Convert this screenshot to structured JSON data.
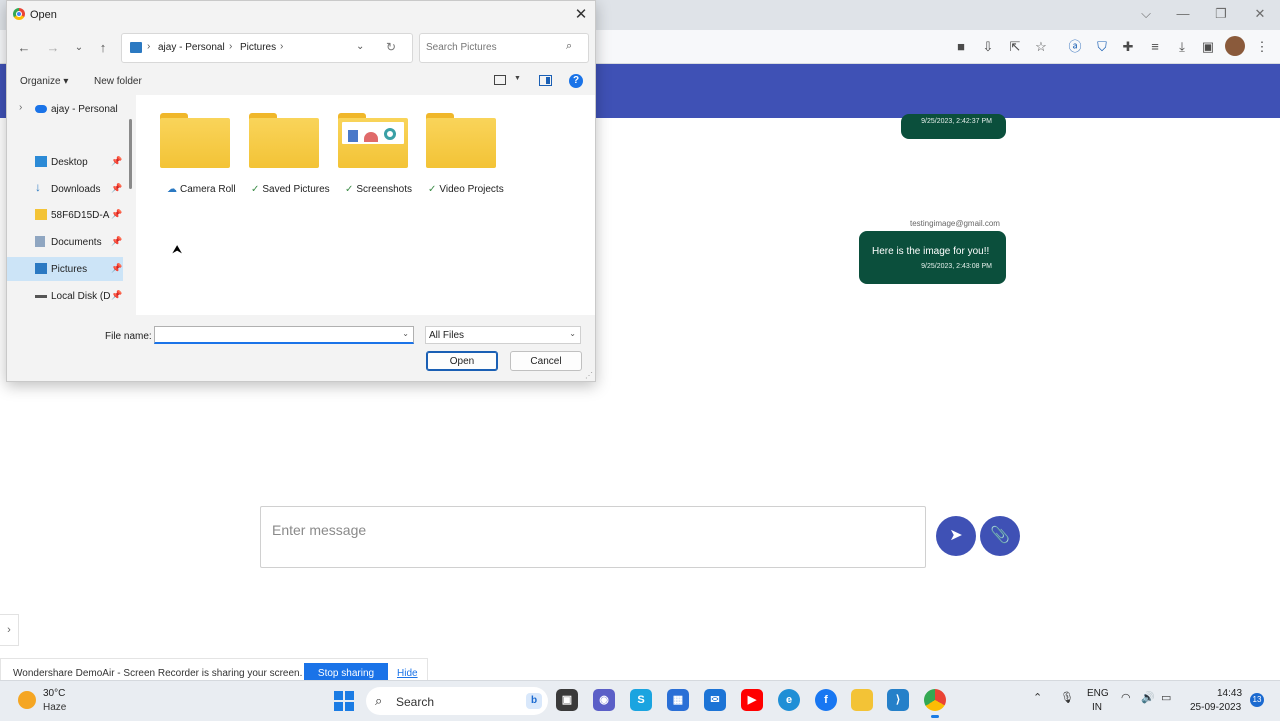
{
  "browser": {
    "toolbar_icons": [
      "video-icon",
      "install-icon",
      "share-icon",
      "star-icon",
      "extension-a-icon",
      "shield-icon",
      "puzzle-icon",
      "reading-list-icon",
      "download-icon",
      "side-panel-icon",
      "menu-icon"
    ]
  },
  "chat": {
    "messages": [
      {
        "timestamp": "9/25/2023, 2:42:37 PM"
      },
      {
        "sender": "testingimage@gmail.com",
        "text": "Here is the image for you!!",
        "timestamp": "9/25/2023, 2:43:08 PM"
      }
    ],
    "input_placeholder": "Enter message",
    "send_icon": "send-icon",
    "attach_icon": "paperclip-icon",
    "bubble_color": "#0b4f3c",
    "accent": "#3f51b5"
  },
  "share_bar": {
    "text": "Wondershare DemoAir - Screen Recorder is sharing your screen.",
    "stop_label": "Stop sharing",
    "hide_label": "Hide"
  },
  "dialog": {
    "title": "Open",
    "path": [
      "ajay - Personal",
      "Pictures"
    ],
    "search_placeholder": "Search Pictures",
    "organize_label": "Organize ▾",
    "new_folder_label": "New folder",
    "help_label": "?",
    "nav_items": [
      {
        "label": "ajay - Personal",
        "icon": "onedrive-icon"
      },
      {
        "label": "Desktop",
        "icon": "desktop-icon"
      },
      {
        "label": "Downloads",
        "icon": "download-arrow-icon"
      },
      {
        "label": "58F6D15D-A",
        "icon": "folder-icon"
      },
      {
        "label": "Documents",
        "icon": "document-icon"
      },
      {
        "label": "Pictures",
        "icon": "pictures-icon",
        "selected": true
      },
      {
        "label": "Local Disk (D",
        "icon": "drive-icon"
      }
    ],
    "folders": [
      {
        "name": "Camera Roll",
        "status": "cloud"
      },
      {
        "name": "Saved Pictures",
        "status": "synced"
      },
      {
        "name": "Screenshots",
        "status": "synced"
      },
      {
        "name": "Video Projects",
        "status": "synced"
      }
    ],
    "file_name_label": "File name:",
    "file_name_value": "",
    "file_type": "All Files",
    "open_label": "Open",
    "cancel_label": "Cancel"
  },
  "taskbar": {
    "temperature": "30°C",
    "condition": "Haze",
    "search_label": "Search",
    "lang_line1": "ENG",
    "lang_line2": "IN",
    "time": "14:43",
    "date": "25-09-2023",
    "notifications": "13"
  }
}
